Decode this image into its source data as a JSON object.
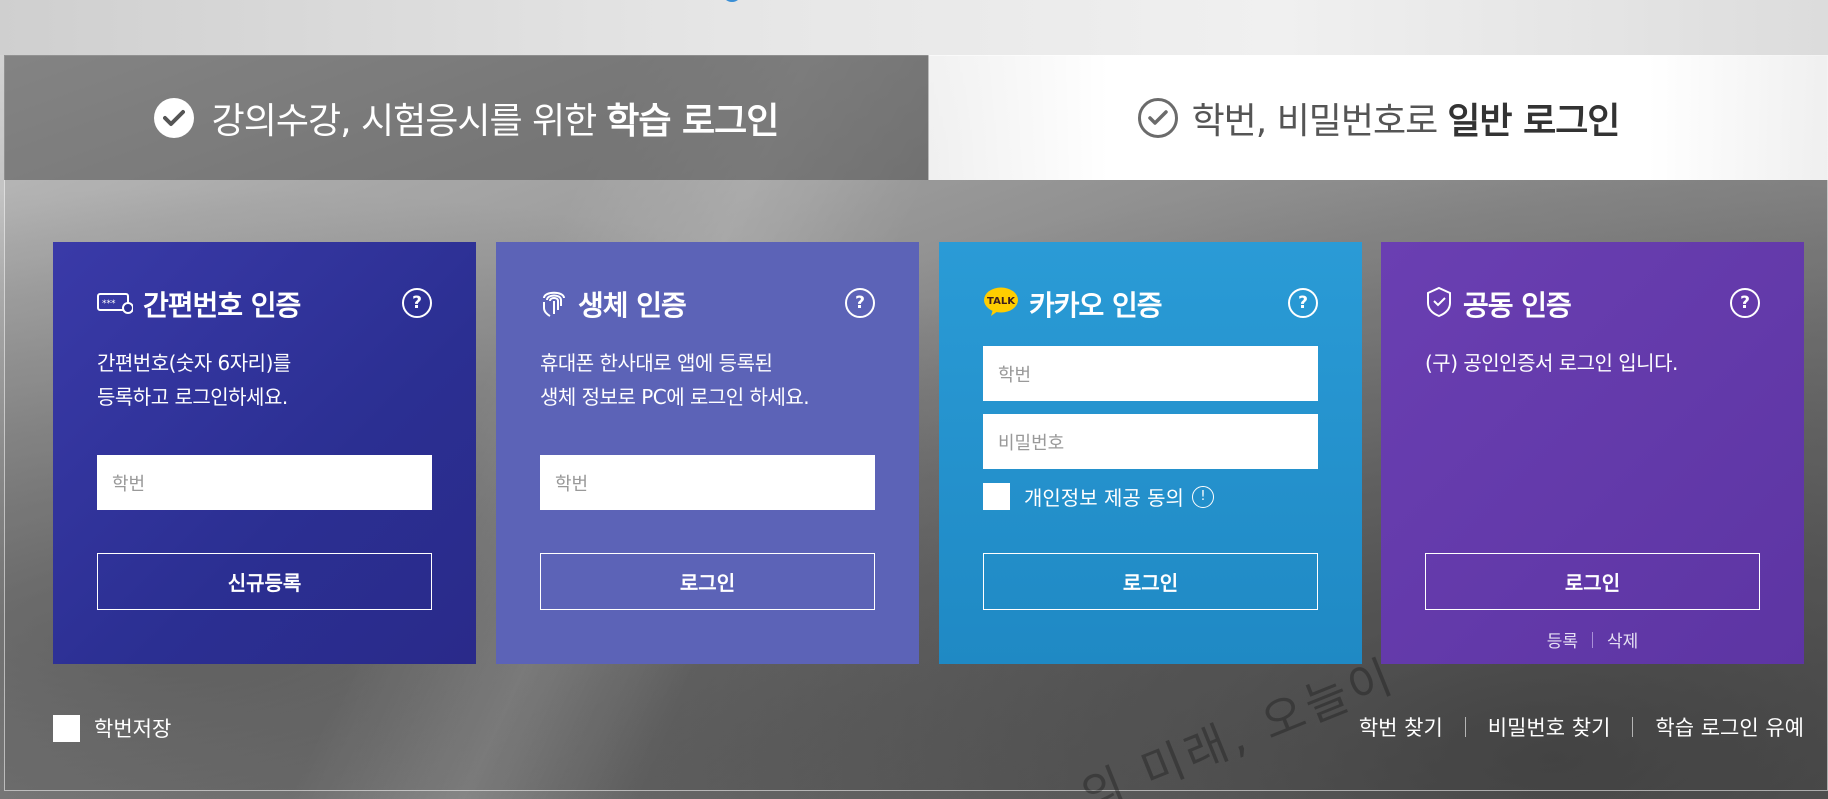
{
  "tabs": {
    "learn": {
      "prefix": "강의수강, 시험응시를 위한",
      "bold": "학습 로그인"
    },
    "general": {
      "prefix": "학번, 비밀번호로",
      "bold": "일반 로그인"
    }
  },
  "cards": {
    "simple": {
      "title": "간편번호 인증",
      "help": "?",
      "desc_line1": "간편번호(숫자 6자리)를",
      "desc_line2": "등록하고 로그인하세요.",
      "input_placeholder": "학번",
      "button": "신규등록",
      "icon": "pin-pad-icon"
    },
    "bio": {
      "title": "생체 인증",
      "help": "?",
      "desc_line1": "휴대폰 한사대로 앱에 등록된",
      "desc_line2": "생체 정보로 PC에 로그인 하세요.",
      "input_placeholder": "학번",
      "button": "로그인",
      "icon": "fingerprint-icon"
    },
    "kakao": {
      "title": "카카오 인증",
      "help": "?",
      "id_placeholder": "학번",
      "pw_placeholder": "비밀번호",
      "agree_label": "개인정보 제공 동의",
      "info": "!",
      "button": "로그인",
      "icon": "kakao-talk-icon",
      "icon_text": "TALK"
    },
    "cert": {
      "title": "공동 인증",
      "help": "?",
      "desc_line1": "(구) 공인인증서 로그인 입니다.",
      "button": "로그인",
      "link_register": "등록",
      "link_delete": "삭제",
      "icon": "shield-check-icon"
    }
  },
  "footer": {
    "save_id": "학번저장",
    "find_id": "학번 찾기",
    "find_pw": "비밀번호 찾기",
    "login_notice": "학습 로그인 유예"
  },
  "colors": {
    "simple": "#2b2f92",
    "bio": "#5c63b7",
    "kakao": "#2196d0",
    "cert": "#6339a9",
    "kakao_yellow": "#ffcd00"
  }
}
